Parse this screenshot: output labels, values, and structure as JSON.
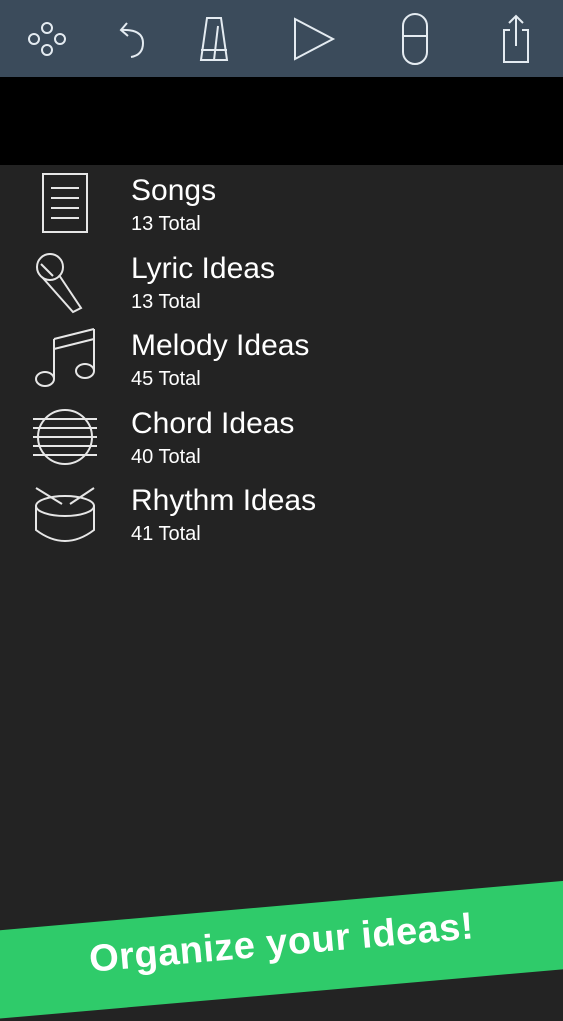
{
  "toolbar": {
    "icons": [
      "menu-circles-icon",
      "undo-icon",
      "metronome-icon",
      "play-icon",
      "record-icon",
      "share-icon"
    ]
  },
  "categories": [
    {
      "title": "Songs",
      "count": "13 Total",
      "icon": "document-icon"
    },
    {
      "title": "Lyric Ideas",
      "count": "13 Total",
      "icon": "microphone-icon"
    },
    {
      "title": "Melody Ideas",
      "count": "45 Total",
      "icon": "music-note-icon"
    },
    {
      "title": "Chord Ideas",
      "count": "40 Total",
      "icon": "chord-icon"
    },
    {
      "title": "Rhythm Ideas",
      "count": "41 Total",
      "icon": "drum-icon"
    }
  ],
  "banner": {
    "text": "Organize your ideas!"
  },
  "colors": {
    "toolbar": "#3b4b5b",
    "background": "#232323",
    "banner": "#2fcb6a"
  }
}
